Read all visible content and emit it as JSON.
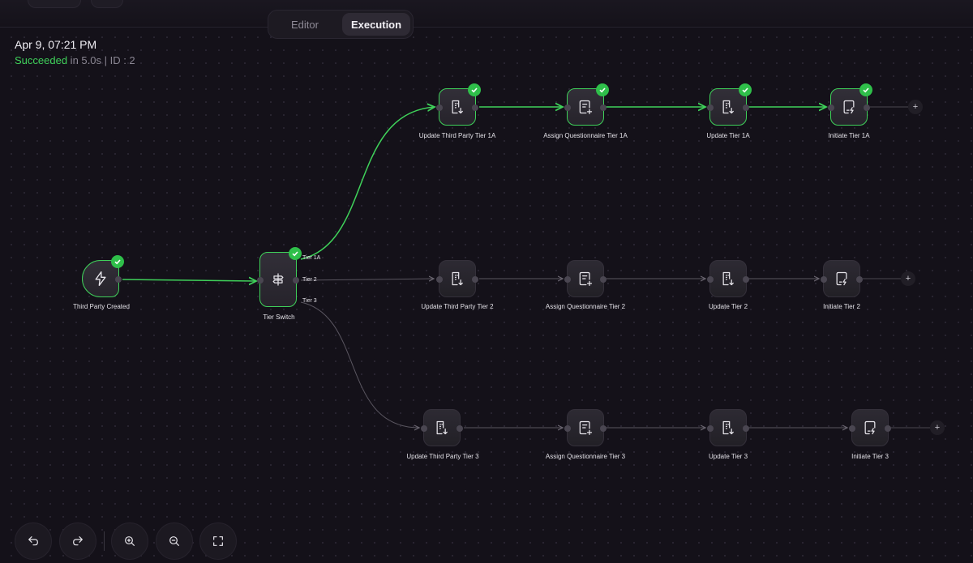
{
  "tabs": [
    {
      "label": "Editor",
      "active": false
    },
    {
      "label": "Execution",
      "active": true
    }
  ],
  "execution": {
    "date": "Apr 9, 07:21 PM",
    "status": "Succeeded",
    "duration": " in 5.0s | ID : 2"
  },
  "nodes": {
    "trigger": {
      "label": "Third Party Created",
      "icon": "lightning-icon",
      "succeeded": true
    },
    "switch": {
      "label": "Tier Switch",
      "icon": "switch-icon",
      "succeeded": true,
      "outputs": [
        "Tier 1A",
        "Tier 2",
        "Tier 3"
      ]
    },
    "tier1a": [
      {
        "label": "Update Third Party Tier 1A",
        "icon": "building-update-icon",
        "succeeded": true
      },
      {
        "label": "Assign Questionnaire Tier 1A",
        "icon": "questionnaire-add-icon",
        "succeeded": true
      },
      {
        "label": "Update Tier 1A",
        "icon": "building-update-icon",
        "succeeded": true
      },
      {
        "label": "Initiate Tier 1A",
        "icon": "tablet-bolt-icon",
        "succeeded": true
      }
    ],
    "tier2": [
      {
        "label": "Update Third Party Tier 2",
        "icon": "building-update-icon",
        "succeeded": false
      },
      {
        "label": "Assign Questionnaire Tier 2",
        "icon": "questionnaire-add-icon",
        "succeeded": false
      },
      {
        "label": "Update Tier 2",
        "icon": "building-update-icon",
        "succeeded": false
      },
      {
        "label": "Initiate Tier 2",
        "icon": "tablet-bolt-icon",
        "succeeded": false
      }
    ],
    "tier3": [
      {
        "label": "Update Third Party Tier 3",
        "icon": "building-update-icon",
        "succeeded": false
      },
      {
        "label": "Assign Questionnaire Tier 3",
        "icon": "questionnaire-add-icon",
        "succeeded": false
      },
      {
        "label": "Update Tier 3",
        "icon": "building-update-icon",
        "succeeded": false
      },
      {
        "label": "Initiate Tier 3",
        "icon": "tablet-bolt-icon",
        "succeeded": false
      }
    ]
  },
  "toolbar": [
    {
      "name": "undo-icon"
    },
    {
      "name": "redo-icon"
    },
    {
      "name": "zoom-in-icon"
    },
    {
      "name": "zoom-out-icon"
    },
    {
      "name": "fit-view-icon"
    }
  ],
  "colors": {
    "success": "#3fd15a",
    "edge_idle": "#5a5660",
    "background": "#141119"
  }
}
